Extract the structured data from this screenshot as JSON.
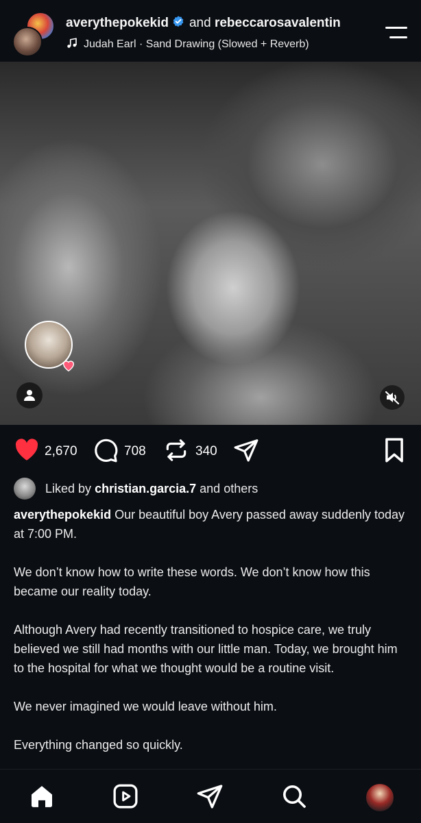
{
  "header": {
    "user1": "averythepokekid",
    "joiner": "and",
    "user2": "rebeccarosavalentin",
    "audio": "Judah Earl · Sand Drawing (Slowed + Reverb)",
    "verified_color": "#3897f0"
  },
  "actions": {
    "likes": "2,670",
    "comments": "708",
    "reposts": "340",
    "liked": true,
    "like_color": "#ff3040"
  },
  "liked_by": {
    "prefix": "Liked by",
    "user": "christian.garcia.7",
    "suffix": "and others"
  },
  "caption": {
    "username": "averythepokekid",
    "paragraphs": [
      "Our beautiful boy Avery passed away suddenly today at 7:00 PM.",
      "We don’t know how to write these words. We don’t know how this became our reality today.",
      "Although Avery had recently transitioned to hospice care, we truly believed we still had months with our little man. Today, we brought him to the hospital for what we thought would be a routine visit.",
      "We never imagined we would leave without him.",
      "Everything changed so quickly."
    ]
  },
  "icons": {
    "menu": "hamburger-icon",
    "music": "music-note-icon",
    "like": "heart-icon",
    "comment": "comment-icon",
    "repost": "repost-icon",
    "share": "share-icon",
    "save": "bookmark-icon",
    "user_tags": "person-icon",
    "mute": "muted-speaker-icon",
    "nav": [
      "home-icon",
      "reels-icon",
      "send-icon",
      "search-icon",
      "profile-avatar"
    ]
  }
}
